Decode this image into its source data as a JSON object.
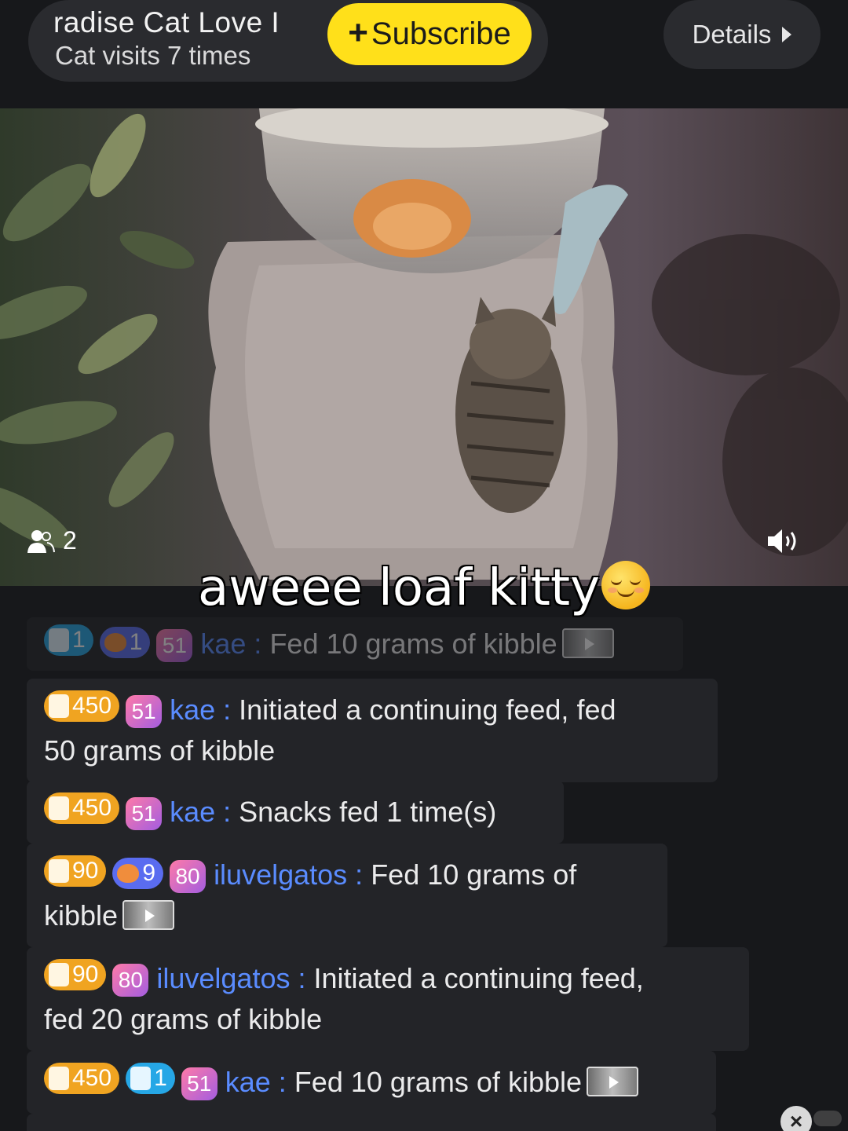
{
  "header": {
    "channel_title": "radise   Cat Love I",
    "channel_subtitle": "Cat visits 7 times",
    "subscribe_label": "Subscribe",
    "details_label": "Details"
  },
  "video": {
    "viewer_count": "2",
    "caption": "aweee loaf kitty"
  },
  "chat": {
    "messages": [
      {
        "badges": [
          "1",
          "1"
        ],
        "level": "51",
        "user": "kae",
        "separator": ":",
        "text": "Fed 10 grams of kibble"
      },
      {
        "badges": [
          "450"
        ],
        "level": "51",
        "user": "kae",
        "separator": ":",
        "text": "Initiated a continuing feed, fed",
        "text2": "50 grams of kibble"
      },
      {
        "badges": [
          "450"
        ],
        "level": "51",
        "user": "kae",
        "separator": ":",
        "text": "Snacks fed 1 time(s)"
      },
      {
        "badges": [
          "90",
          "9"
        ],
        "level": "80",
        "user": "iluvelgatos",
        "separator": ":",
        "text": "Fed 10 grams of",
        "text2": "kibble"
      },
      {
        "badges": [
          "90"
        ],
        "level": "80",
        "user": "iluvelgatos",
        "separator": ":",
        "text": "Initiated a continuing feed,",
        "text2": "fed 20 grams of kibble"
      },
      {
        "badges": [
          "450",
          "1"
        ],
        "level": "51",
        "user": "kae",
        "separator": ":",
        "text": "Fed 10 grams of kibble"
      }
    ]
  },
  "colors": {
    "background": "#17181b",
    "subscribe_accent": "#ffe01a",
    "username": "#5a8cff",
    "food_badge": "#f0a421",
    "snack_badge": "#26a7e6",
    "cat_badge": "#5a6cf0"
  }
}
